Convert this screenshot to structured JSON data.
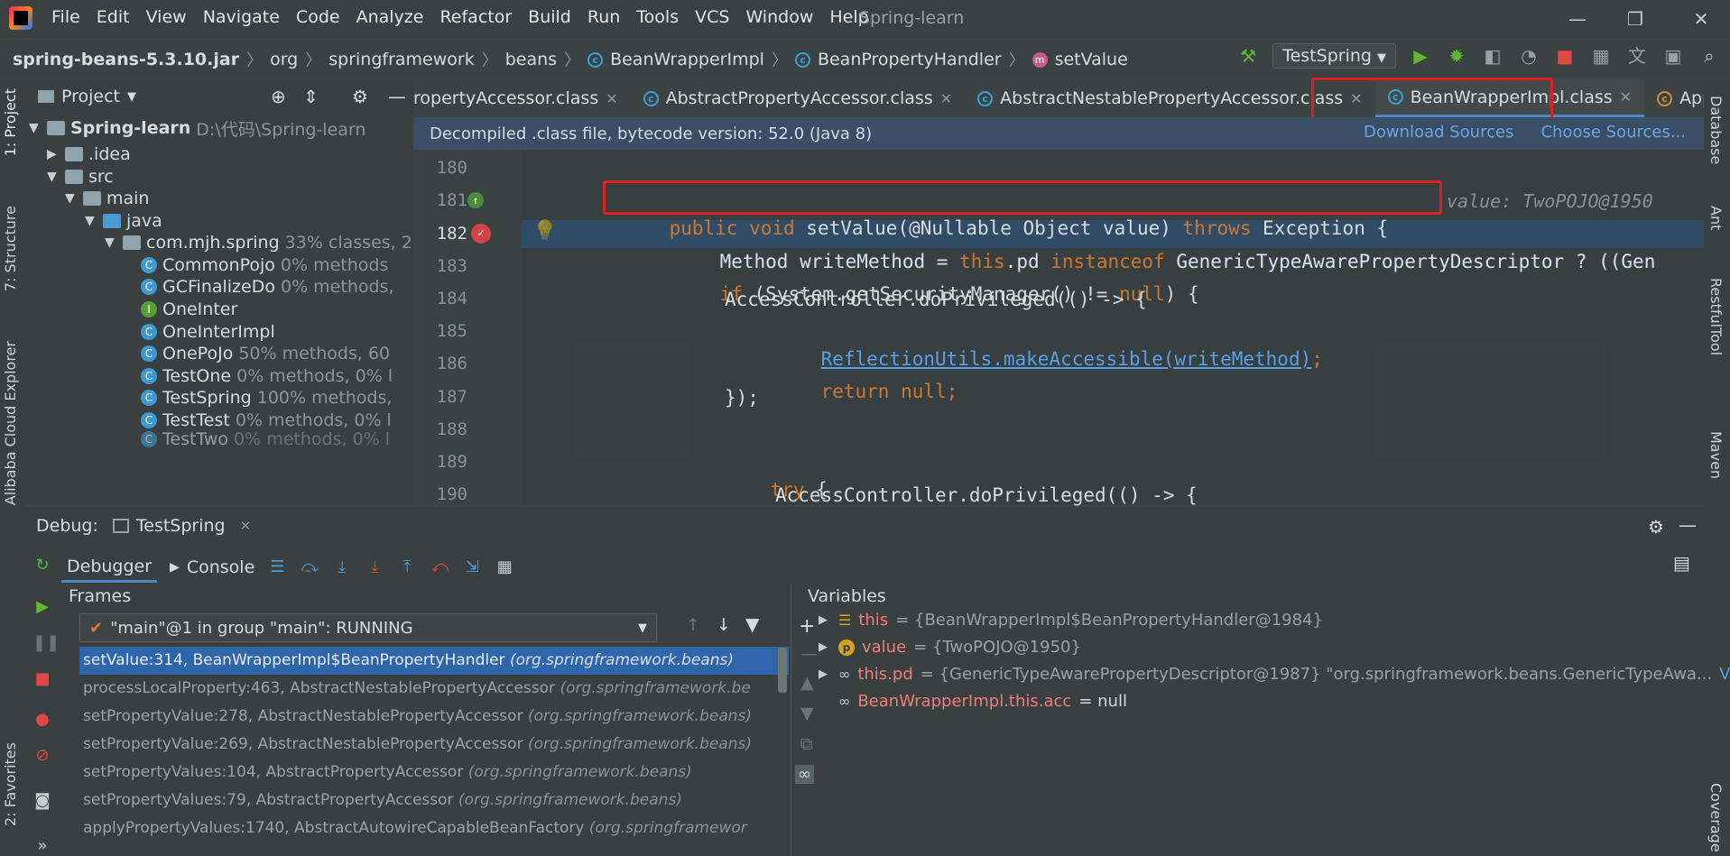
{
  "menubar": {
    "items": [
      "File",
      "Edit",
      "View",
      "Navigate",
      "Code",
      "Analyze",
      "Refactor",
      "Build",
      "Run",
      "Tools",
      "VCS",
      "Window",
      "Help"
    ],
    "title": "Spring-learn"
  },
  "breadcrumbs": {
    "jar": "spring-beans-5.3.10.jar",
    "p1": "org",
    "p2": "springframework",
    "p3": "beans",
    "c1": "BeanWrapperImpl",
    "c2": "BeanPropertyHandler",
    "m1": "setValue"
  },
  "run_config": "TestSpring",
  "project": {
    "header": "Project",
    "root_name": "Spring-learn",
    "root_path": "D:\\代码\\Spring-learn",
    "idea": ".idea",
    "src": "src",
    "main": "main",
    "java": "java",
    "pkg": "com.mjh.spring",
    "pkg_cov": "33% classes, 2",
    "files": [
      {
        "name": "CommonPojo",
        "cov": "0% methods"
      },
      {
        "name": "GCFinalizeDo",
        "cov": "0% methods,"
      },
      {
        "name": "OneInter",
        "cov": ""
      },
      {
        "name": "OneInterImpl",
        "cov": ""
      },
      {
        "name": "OnePoJo",
        "cov": "50% methods, 60"
      },
      {
        "name": "TestOne",
        "cov": "0% methods, 0% l"
      },
      {
        "name": "TestSpring",
        "cov": "100% methods,"
      },
      {
        "name": "TestTest",
        "cov": "0% methods, 0% l"
      },
      {
        "name": "TestTwo",
        "cov": "0% methods, 0% l"
      }
    ]
  },
  "left_tabs": {
    "project": "1: Project",
    "structure": "7: Structure",
    "alibaba": "Alibaba Cloud Explorer",
    "favorites": "2: Favorites"
  },
  "right_tabs": {
    "database": "Database",
    "ant": "Ant",
    "restful": "RestfulTool",
    "maven": "Maven",
    "coverage": "Coverage"
  },
  "tabs": [
    {
      "label": "ropertyAccessor.class"
    },
    {
      "label": "AbstractPropertyAccessor.class"
    },
    {
      "label": "AbstractNestablePropertyAccessor.class"
    },
    {
      "label": "BeanWrapperImpl.class"
    },
    {
      "label": "Applicatio"
    }
  ],
  "notice": {
    "text": "Decompiled .class file, bytecode version: 52.0 (Java 8)",
    "download": "Download Sources",
    "choose": "Choose Sources..."
  },
  "code": {
    "lines": [
      "180",
      "181",
      "182",
      "183",
      "184",
      "185",
      "186",
      "187",
      "188",
      "189",
      "190"
    ],
    "l181_kw1": "public void ",
    "l181_sig": "setValue(@Nullable Object value) ",
    "l181_kw2": "throws ",
    "l181_rest": "Exception {",
    "l181_hint": "value: TwoPOJO@1950",
    "l182_a": "Method writeMethod = ",
    "l182_kw": "this",
    "l182_b": ".pd ",
    "l182_kw2": "instanceof ",
    "l182_c": "GenericTypeAwarePropertyDescriptor ? ((Gen",
    "l183_kw": "if ",
    "l183_a": "(System.getSecurityManager() != ",
    "l183_kw2": "null",
    "l183_b": ") {",
    "l184": "AccessController.doPrivileged(() -> {",
    "l185": "ReflectionUtils.makeAccessible(writeMethod)",
    "l185_end": ";",
    "l186_kw": "return ",
    "l186_kw2": "null",
    "l186_end": ";",
    "l187": "});",
    "l189_kw": "try ",
    "l189_b": "{",
    "l190": "AccessController.doPrivileged(() -> {"
  },
  "debug": {
    "label": "Debug:",
    "session": "TestSpring",
    "tab_debugger": "Debugger",
    "tab_console": "Console",
    "frames_header": "Frames",
    "variables_header": "Variables",
    "thread": "\"main\"@1 in group \"main\": RUNNING",
    "frames": [
      {
        "m": "setValue:314, BeanWrapperImpl$BeanPropertyHandler ",
        "p": "(org.springframework.beans)"
      },
      {
        "m": "processLocalProperty:463, AbstractNestablePropertyAccessor ",
        "p": "(org.springframework.be"
      },
      {
        "m": "setPropertyValue:278, AbstractNestablePropertyAccessor ",
        "p": "(org.springframework.beans)"
      },
      {
        "m": "setPropertyValue:269, AbstractNestablePropertyAccessor ",
        "p": "(org.springframework.beans)"
      },
      {
        "m": "setPropertyValues:104, AbstractPropertyAccessor ",
        "p": "(org.springframework.beans)"
      },
      {
        "m": "setPropertyValues:79, AbstractPropertyAccessor ",
        "p": "(org.springframework.beans)"
      },
      {
        "m": "applyPropertyValues:1740, AbstractAutowireCapableBeanFactory ",
        "p": "(org.springframewor"
      }
    ],
    "vars": [
      {
        "name": "this",
        "val": "= {BeanWrapperImpl$BeanPropertyHandler@1984}"
      },
      {
        "name": "value",
        "val": "= {TwoPOJO@1950}"
      },
      {
        "name": "this.pd",
        "val": "= {GenericTypeAwarePropertyDescriptor@1987} \"org.springframework.beans.GenericTypeAwa...",
        "link": "View"
      },
      {
        "name": "BeanWrapperImpl.this.acc",
        "val": "= null"
      }
    ]
  }
}
